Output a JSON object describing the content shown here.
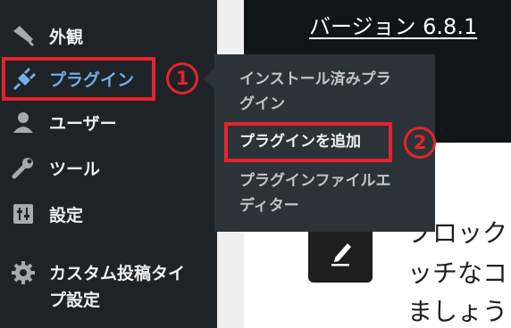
{
  "sidebar": {
    "items": [
      {
        "label": "外観",
        "icon": "paintbrush-icon"
      },
      {
        "label": "プラグイン",
        "icon": "plug-icon",
        "active": true
      },
      {
        "label": "ユーザー",
        "icon": "user-icon"
      },
      {
        "label": "ツール",
        "icon": "wrench-icon"
      },
      {
        "label": "設定",
        "icon": "settings-sliders-icon"
      },
      {
        "label_line1": "カスタム投稿タイ",
        "label_line2": "プ設定",
        "icon": "gear-icon"
      }
    ]
  },
  "submenu": {
    "items": [
      {
        "line1": "インストール済みプラ",
        "line2": "グイン"
      },
      {
        "line1": "プラグインを追加"
      },
      {
        "line1": "プラグインファイルエ",
        "line2": "ディター"
      }
    ]
  },
  "banner": {
    "version_text": "バージョン 6.8.1"
  },
  "promo": {
    "lines": [
      "ブロック",
      "ッチなコ",
      "ましょう"
    ]
  },
  "annotations": {
    "step1": "1",
    "step2": "2"
  },
  "colors": {
    "sidebar_bg": "#1d2327",
    "submenu_bg": "#2c3338",
    "active_text": "#72aee6",
    "highlight_red": "#e5232e"
  }
}
